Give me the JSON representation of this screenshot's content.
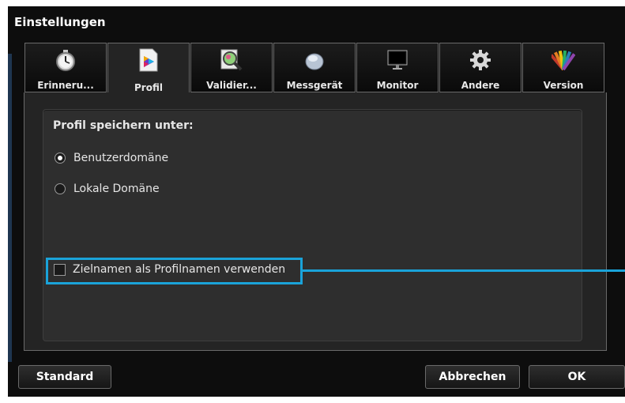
{
  "window": {
    "title": "Einstellungen"
  },
  "tabs": [
    {
      "label": "Erinneru...",
      "icon": "stopwatch-icon"
    },
    {
      "label": "Profil",
      "icon": "color-profile-icon"
    },
    {
      "label": "Validier...",
      "icon": "validation-magnifier-icon"
    },
    {
      "label": "Messgerät",
      "icon": "measuring-device-icon"
    },
    {
      "label": "Monitor",
      "icon": "monitor-icon"
    },
    {
      "label": "Andere",
      "icon": "gear-icon"
    },
    {
      "label": "Version",
      "icon": "color-swatch-fan-icon"
    }
  ],
  "active_tab": "Profil",
  "profile": {
    "save_under_label": "Profil speichern unter:",
    "options": [
      {
        "label": "Benutzerdomäne",
        "selected": true
      },
      {
        "label": "Lokale Domäne",
        "selected": false
      }
    ],
    "use_target_name_label": "Zielnamen als Profilnamen verwenden",
    "use_target_name_checked": false
  },
  "buttons": {
    "standard": "Standard",
    "cancel": "Abbrechen",
    "ok": "OK"
  },
  "colors": {
    "highlight": "#1aa3d9",
    "background": "#0d0d0d",
    "panel": "#2e2e2e"
  }
}
